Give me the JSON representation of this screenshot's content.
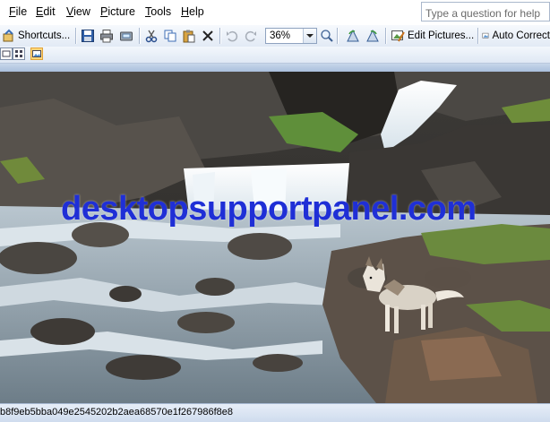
{
  "menu": {
    "items": [
      "File",
      "Edit",
      "View",
      "Picture",
      "Tools",
      "Help"
    ]
  },
  "toolbar": {
    "shortcuts_label": "Shortcuts...",
    "zoom_value": "36%",
    "edit_pictures_label": "Edit Pictures...",
    "auto_correct_label": "Auto Correct",
    "help_placeholder": "Type a question for help"
  },
  "picture": {
    "watermark": "desktopsupportpanel.com"
  },
  "status": {
    "filename": "b8f9eb5bba049e2545202b2aea68570e1f267986f8e8"
  },
  "colors": {
    "toolbar_top": "#f6f9fd",
    "toolbar_bottom": "#e2eaf5",
    "watermark": "#1f2fd6",
    "active_view": "#ffd77a"
  }
}
